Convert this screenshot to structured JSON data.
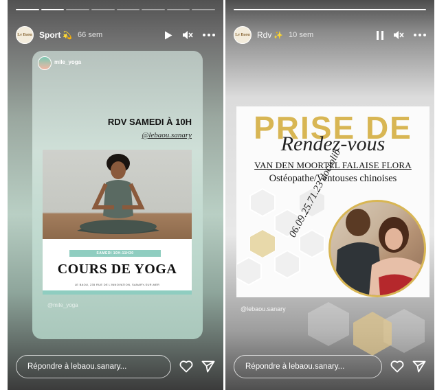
{
  "stories": [
    {
      "progress_total": 8,
      "progress_done": 2,
      "header": {
        "avatar_text": "Le Baou",
        "username": "Sport",
        "emoji": "💫",
        "time": "66 sem"
      },
      "inner_post": {
        "author": "mile_yoga",
        "rdv_text": "RDV SAMEDI À 10H",
        "mention": "@lebaou.sanary",
        "banner": "SAMEDI 10H-11H30",
        "title": "COURS DE YOGA",
        "address": "LE BAOU, 235 RUE DE L'INNOVATION, SANARY-SUR-MER",
        "watermark": "@mile_yoga"
      },
      "reply_placeholder": "Répondre à lebaou.sanary..."
    },
    {
      "progress_total": 1,
      "progress_done": 1,
      "header": {
        "avatar_text": "Le Baou",
        "username": "Rdv",
        "emoji": "✨",
        "time": "10 sem"
      },
      "post": {
        "headline": "PRISE DE",
        "script": "Rendez-vous",
        "name": "VAN DEN MOORTEL FALAISE FLORA",
        "specialty": "Ostéopathe/Ventouses chinoises",
        "phone": "06.09.25.71.23 doctolib",
        "watermark": "@lebaou.sanary"
      },
      "reply_placeholder": "Répondre à lebaou.sanary..."
    }
  ],
  "icons": [
    "play-icon",
    "mute-icon",
    "more-icon",
    "pause-icon",
    "heart-icon",
    "send-icon"
  ],
  "colors": {
    "gold": "#d8b654",
    "teal": "#8fcdc0"
  }
}
